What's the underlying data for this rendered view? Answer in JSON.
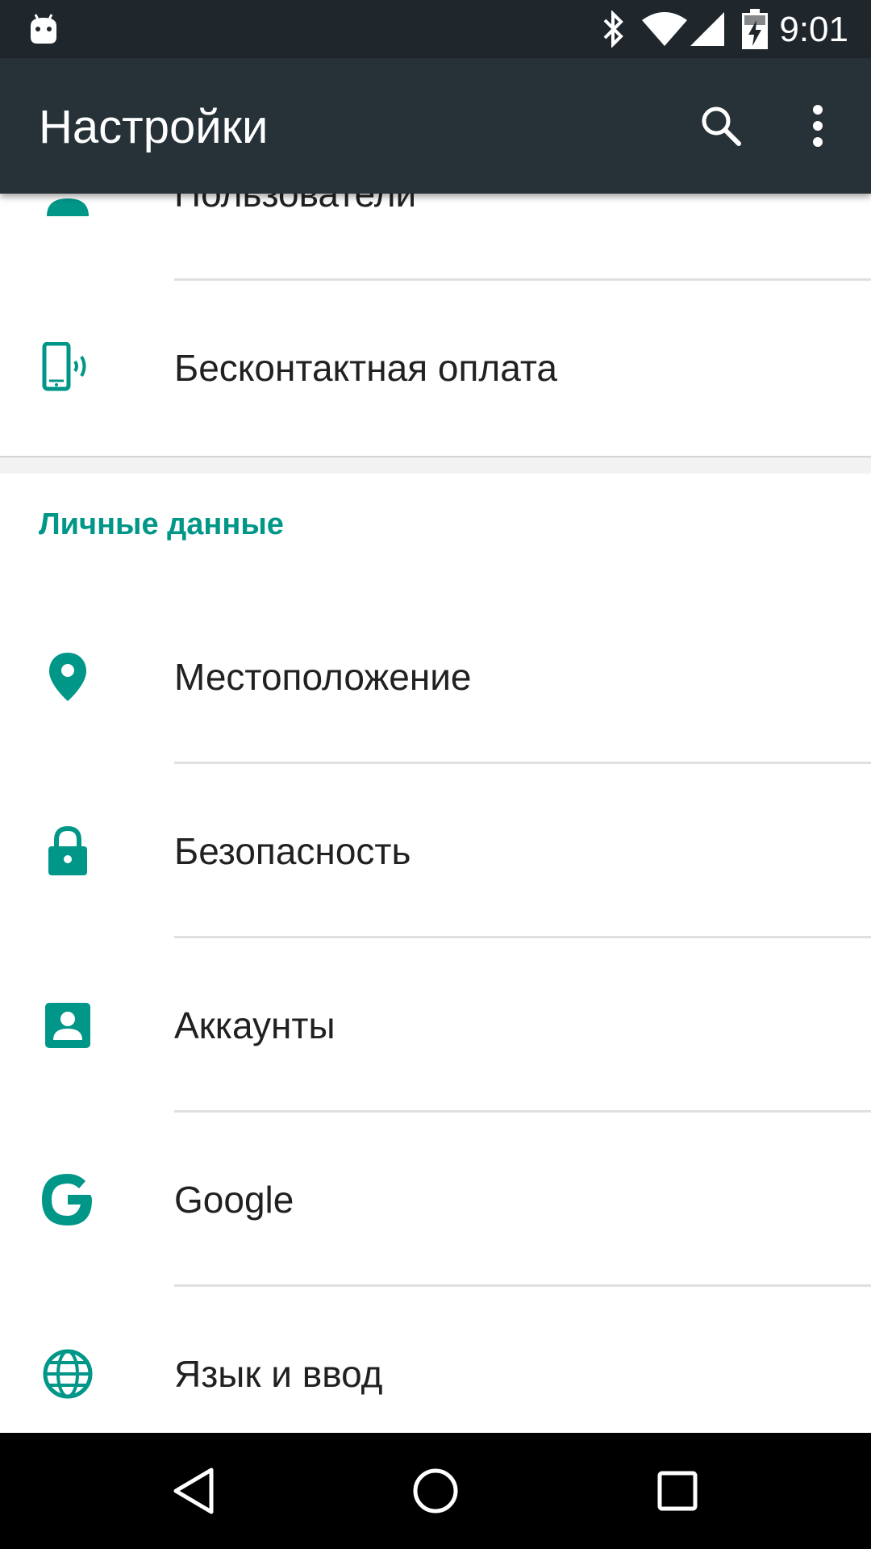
{
  "status_bar": {
    "time": "9:01",
    "icons": [
      "android-notification-icon",
      "bluetooth-icon",
      "wifi-icon",
      "signal-icon",
      "battery-charging-icon"
    ]
  },
  "app_bar": {
    "title": "Настройки",
    "search_icon": "search-icon",
    "overflow_icon": "more-vert-icon",
    "color": "#263238"
  },
  "list": {
    "top_items": [
      {
        "label": "Пользователи",
        "icon": "person-icon"
      },
      {
        "label": "Бесконтактная оплата",
        "icon": "nfc-phone-icon"
      }
    ],
    "category": {
      "title": "Личные данные",
      "items": [
        {
          "label": "Местоположение",
          "icon": "location-pin-icon"
        },
        {
          "label": "Безопасность",
          "icon": "lock-icon"
        },
        {
          "label": "Аккаунты",
          "icon": "account-box-icon"
        },
        {
          "label": "Google",
          "icon": "google-g-icon"
        },
        {
          "label": "Язык и ввод",
          "icon": "globe-icon"
        }
      ]
    }
  },
  "nav_bar": {
    "buttons": [
      "back-icon",
      "home-icon",
      "recents-icon"
    ]
  },
  "colors": {
    "accent": "#009688",
    "status_bar": "#1f272c",
    "text_primary": "#212121"
  }
}
